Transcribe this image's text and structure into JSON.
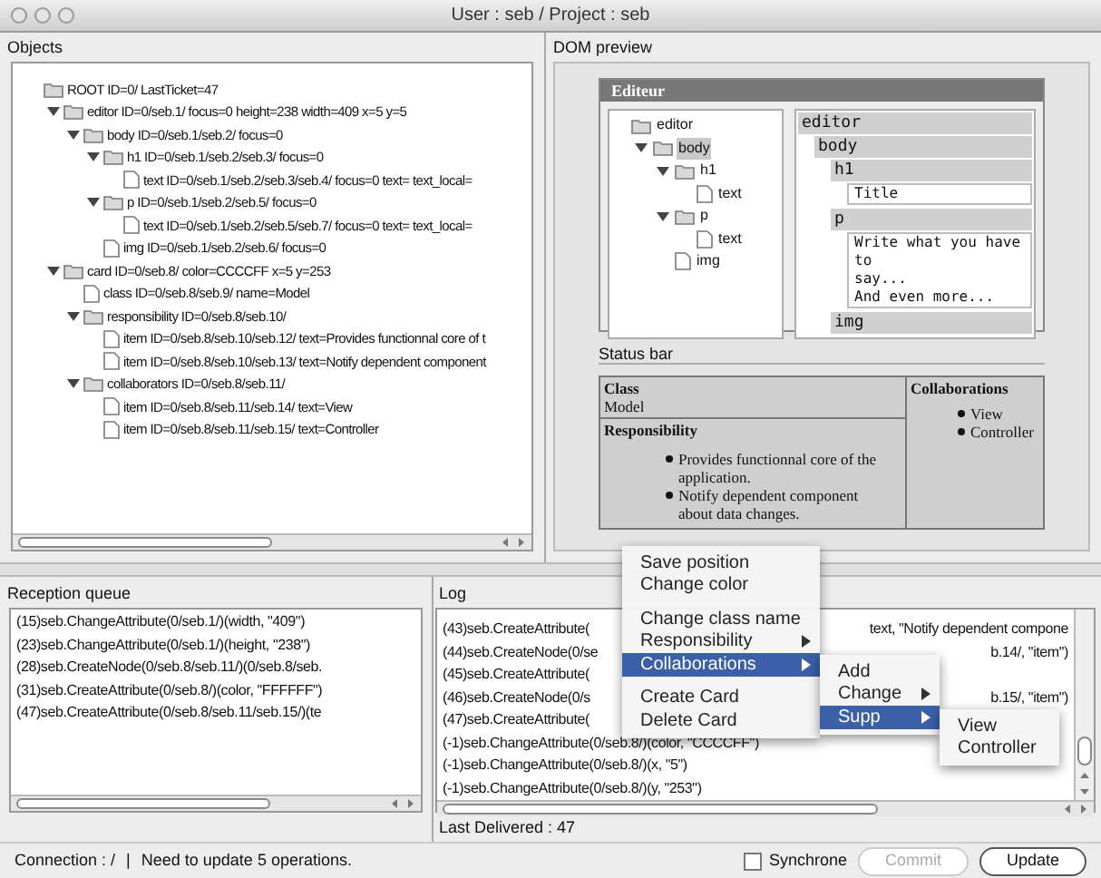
{
  "window": {
    "title": "User : seb / Project : seb"
  },
  "objects": {
    "title": "Objects",
    "tree": [
      {
        "kind": "root",
        "label": "ROOT ID=0/ LastTicket=47",
        "children": [
          {
            "kind": "folder",
            "label": "editor ID=0/seb.1/ focus=0 height=238 width=409 x=5 y=5",
            "expanded": true,
            "children": [
              {
                "kind": "folder",
                "label": "body ID=0/seb.1/seb.2/ focus=0",
                "expanded": true,
                "children": [
                  {
                    "kind": "folder",
                    "label": "h1 ID=0/seb.1/seb.2/seb.3/ focus=0",
                    "expanded": true,
                    "children": [
                      {
                        "kind": "file",
                        "label": "text ID=0/seb.1/seb.2/seb.3/seb.4/ focus=0 text= text_local="
                      }
                    ]
                  },
                  {
                    "kind": "folder",
                    "label": "p ID=0/seb.1/seb.2/seb.5/ focus=0",
                    "expanded": true,
                    "children": [
                      {
                        "kind": "file",
                        "label": "text ID=0/seb.1/seb.2/seb.5/seb.7/ focus=0 text= text_local="
                      }
                    ]
                  },
                  {
                    "kind": "file",
                    "label": "img ID=0/seb.1/seb.2/seb.6/ focus=0"
                  }
                ]
              }
            ]
          },
          {
            "kind": "folder",
            "label": "card ID=0/seb.8/ color=CCCCFF x=5 y=253",
            "expanded": true,
            "children": [
              {
                "kind": "file",
                "label": "class ID=0/seb.8/seb.9/ name=Model"
              },
              {
                "kind": "folder",
                "label": "responsibility ID=0/seb.8/seb.10/",
                "expanded": true,
                "children": [
                  {
                    "kind": "file",
                    "label": "item ID=0/seb.8/seb.10/seb.12/ text=Provides functionnal core of t"
                  },
                  {
                    "kind": "file",
                    "label": "item ID=0/seb.8/seb.10/seb.13/ text=Notify dependent component"
                  }
                ]
              },
              {
                "kind": "folder",
                "label": "collaborators ID=0/seb.8/seb.11/",
                "expanded": true,
                "children": [
                  {
                    "kind": "file",
                    "label": "item ID=0/seb.8/seb.11/seb.14/ text=View"
                  },
                  {
                    "kind": "file",
                    "label": "item ID=0/seb.8/seb.11/seb.15/ text=Controller"
                  }
                ]
              }
            ]
          }
        ]
      }
    ]
  },
  "dom_preview": {
    "title": "DOM preview",
    "editor_title": "Editeur",
    "tree": [
      {
        "kind": "root",
        "label": "editor",
        "selected": false,
        "children": [
          {
            "kind": "folder",
            "label": "body",
            "expanded": true,
            "selected": true,
            "children": [
              {
                "kind": "folder",
                "label": "h1",
                "expanded": true,
                "selected": false,
                "children": [
                  {
                    "kind": "file",
                    "label": "text",
                    "selected": false
                  }
                ]
              },
              {
                "kind": "folder",
                "label": "p",
                "expanded": true,
                "selected": false,
                "children": [
                  {
                    "kind": "file",
                    "label": "text",
                    "selected": false
                  }
                ]
              },
              {
                "kind": "file",
                "label": "img",
                "selected": false
              }
            ]
          }
        ]
      }
    ],
    "structure": {
      "label": "editor",
      "children": [
        {
          "label": "body",
          "children": [
            {
              "label": "h1",
              "content": [
                "Title"
              ]
            },
            {
              "label": "p",
              "content": [
                "Write what you have to",
                "say...",
                "And even more..."
              ]
            },
            {
              "label": "img"
            }
          ]
        }
      ]
    },
    "status_bar_title": "Status bar",
    "card": {
      "class_label": "Class",
      "class_value": "Model",
      "responsibility_label": "Responsibility",
      "responsibilities": [
        "Provides functionnal core of the application.",
        "Notify dependent component about data changes."
      ],
      "collaborations_label": "Collaborations",
      "collaborators": [
        "View",
        "Controller"
      ]
    }
  },
  "reception_queue": {
    "title": "Reception queue",
    "lines": [
      "(15)seb.ChangeAttribute(0/seb.1/)(width, \"409\")",
      "(23)seb.ChangeAttribute(0/seb.1/)(height, \"238\")",
      "(28)seb.CreateNode(0/seb.8/seb.11/)(0/seb.8/seb.",
      "(31)seb.CreateAttribute(0/seb.8/)(color, \"FFFFFF\")",
      "(47)seb.CreateAttribute(0/seb.8/seb.11/seb.15/)(te"
    ]
  },
  "log": {
    "title": "Log",
    "lines": [
      {
        "left": "(43)seb.CreateAttribute(",
        "right": "text, \"Notify dependent compone"
      },
      {
        "left": "(44)seb.CreateNode(0/se",
        "right": "b.14/, \"item\")"
      },
      {
        "left": "(45)seb.CreateAttribute("
      },
      {
        "left": "(46)seb.CreateNode(0/s",
        "right": "b.15/, \"item\")"
      },
      {
        "left": "(47)seb.CreateAttribute("
      },
      {
        "left": "(-1)seb.ChangeAttribute(0/seb.8/)(color, \"CCCCFF\")"
      },
      {
        "left": "(-1)seb.ChangeAttribute(0/seb.8/)(x, \"5\")"
      },
      {
        "left": "(-1)seb.ChangeAttribute(0/seb.8/)(y, \"253\")"
      }
    ],
    "last_delivered": "Last Delivered : 47"
  },
  "status_bar": {
    "connection": "Connection : /",
    "separator": "|",
    "message": "Need to update 5 operations.",
    "synchrone": {
      "label": "Synchrone",
      "checked": false
    },
    "commit": {
      "label": "Commit",
      "disabled": true
    },
    "update": {
      "label": "Update",
      "disabled": false
    }
  },
  "context_menu": {
    "items": [
      {
        "kind": "item",
        "label": "Save position",
        "selected": false
      },
      {
        "kind": "item",
        "label": "Change color",
        "selected": false
      },
      {
        "kind": "separator"
      },
      {
        "kind": "item",
        "label": "Change class name",
        "selected": false
      },
      {
        "kind": "submenu",
        "label": "Responsibility",
        "selected": false
      },
      {
        "kind": "submenu",
        "label": "Collaborations",
        "selected": true
      },
      {
        "kind": "separator"
      },
      {
        "kind": "item",
        "label": "Create Card",
        "selected": false
      },
      {
        "kind": "item",
        "label": "Delete Card",
        "selected": false
      }
    ],
    "submenu": [
      {
        "kind": "item",
        "label": "Add",
        "selected": false
      },
      {
        "kind": "submenu",
        "label": "Change",
        "selected": false
      },
      {
        "kind": "submenu",
        "label": "Supp",
        "selected": true
      }
    ],
    "submenu_2": [
      {
        "kind": "item",
        "label": "View",
        "selected": false
      },
      {
        "kind": "item",
        "label": "Controller",
        "selected": false
      }
    ]
  }
}
